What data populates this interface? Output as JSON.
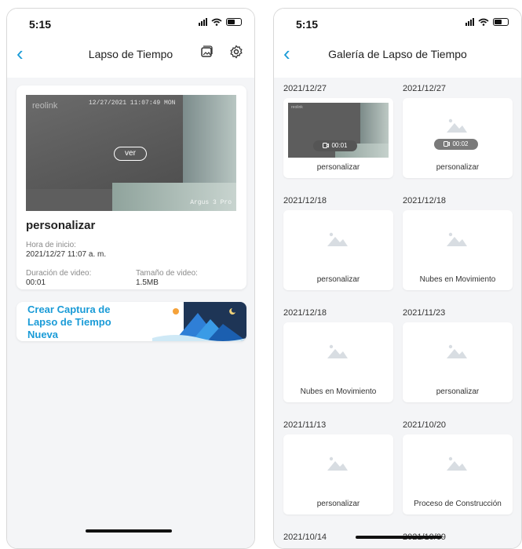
{
  "status": {
    "time": "5:15"
  },
  "left": {
    "nav_title": "Lapso de Tiempo",
    "icons": {
      "back": "chevron-left-icon",
      "gallery": "gallery-icon",
      "settings": "gear-icon"
    },
    "video": {
      "logo": "reolink",
      "timestamp": "12/27/2021 11:07:49 MON",
      "model": "Argus 3 Pro",
      "play_label": "ver"
    },
    "card_title": "personalizar",
    "start_label": "Hora de inicio:",
    "start_value": "2021/12/27 11:07 a. m.",
    "duration_label": "Duración de video:",
    "duration_value": "00:01",
    "size_label": "Tamaño de video:",
    "size_value": "1.5MB",
    "create_label": "Crear Captura de Lapso de Tiempo Nueva"
  },
  "right": {
    "nav_title": "Galería de Lapso de Tiempo",
    "items": [
      {
        "date": "2021/12/27",
        "name": "personalizar",
        "duration": "00:01",
        "has_thumb": true
      },
      {
        "date": "2021/12/27",
        "name": "personalizar",
        "duration": "00:02",
        "has_thumb": false
      },
      {
        "date": "2021/12/18",
        "name": "personalizar"
      },
      {
        "date": "2021/12/18",
        "name": "Nubes en Movimiento"
      },
      {
        "date": "2021/12/18",
        "name": "Nubes en Movimiento"
      },
      {
        "date": "2021/11/23",
        "name": "personalizar"
      },
      {
        "date": "2021/11/13",
        "name": "personalizar"
      },
      {
        "date": "2021/10/20",
        "name": "Proceso de Construcción"
      },
      {
        "date": "2021/10/14"
      },
      {
        "date": "2021/10/09"
      }
    ]
  },
  "colors": {
    "accent": "#1a9bd7",
    "background": "#f4f5f7"
  }
}
